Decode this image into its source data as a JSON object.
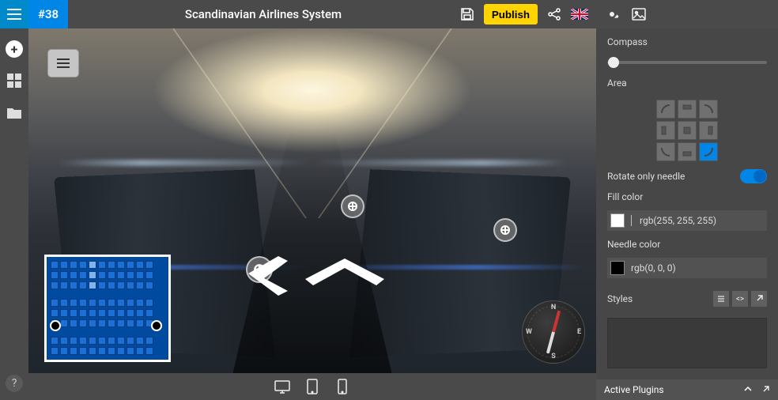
{
  "topbar": {
    "id_badge": "#38",
    "title": "Scandinavian Airlines System",
    "save_label": "Save",
    "publish_label": "Publish",
    "share_label": "Share",
    "lang_flag": "UK"
  },
  "left_rail": {
    "menu": "Menu",
    "add": "Add",
    "layouts": "Layouts",
    "folder": "Folder",
    "help": "?"
  },
  "viewport": {
    "compass": {
      "N": "N",
      "S": "S",
      "E": "E",
      "W": "W"
    }
  },
  "device_bar": {
    "desktop": "Desktop",
    "tablet": "Tablet",
    "phone": "Phone"
  },
  "right_panel": {
    "tabs": {
      "settings": "Settings",
      "image": "Image"
    },
    "compass_label": "Compass",
    "compass_value": 4,
    "area_label": "Area",
    "area_selected": "bottom-right",
    "rotate_label": "Rotate only needle",
    "rotate_value": true,
    "fill_color_label": "Fill color",
    "fill_color_value": "rgb(255, 255, 255)",
    "fill_color_hex": "#ffffff",
    "needle_color_label": "Needle color",
    "needle_color_value": "rgb(0, 0, 0)",
    "needle_color_hex": "#000000",
    "styles_label": "Styles",
    "plugins_label": "Active Plugins"
  }
}
